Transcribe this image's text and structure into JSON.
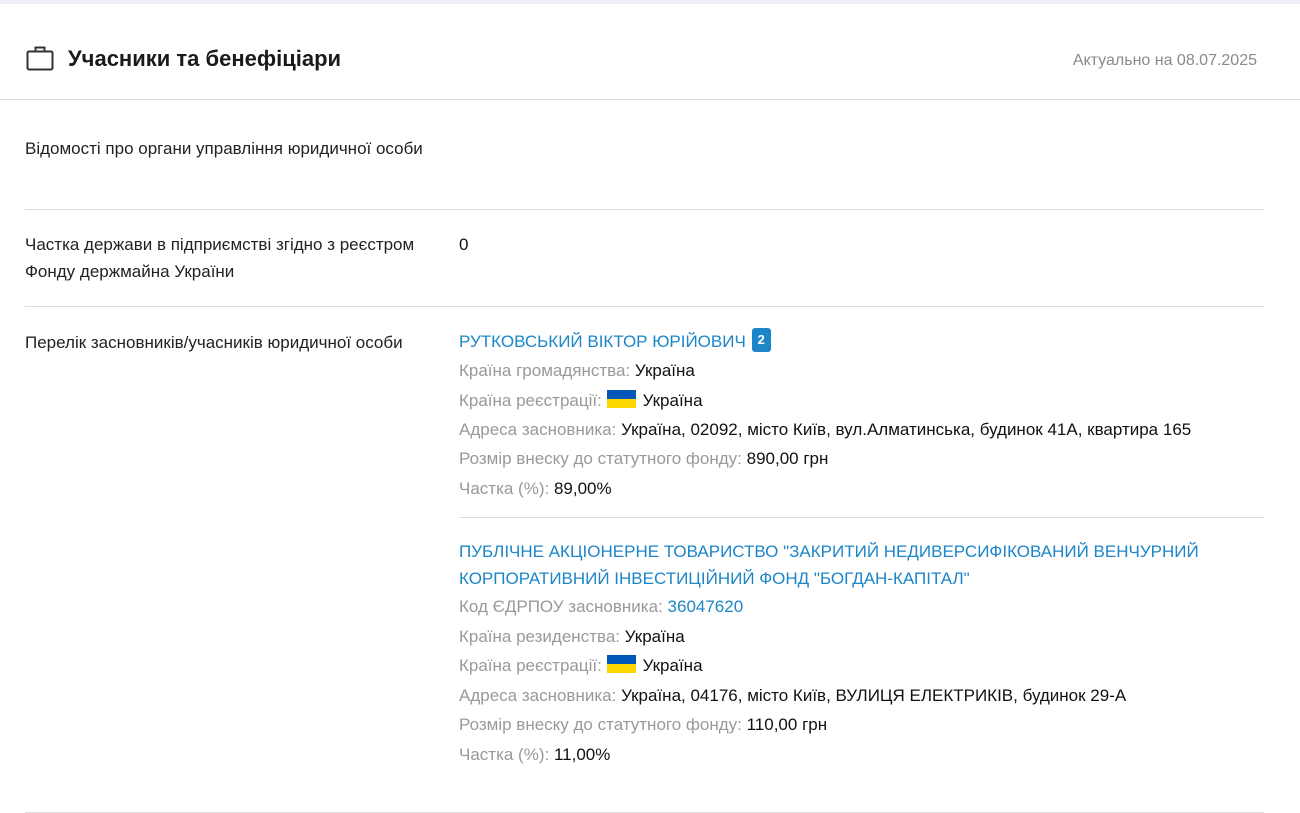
{
  "header": {
    "title": "Учасники та бенефіціари",
    "date": "Актуально на 08.07.2025"
  },
  "rows": {
    "governance": {
      "label": "Відомості про органи управління юридичної особи",
      "value": ""
    },
    "state_share": {
      "label": "Частка держави в підприємстві згідно з реєстром Фонду держмайна України",
      "value": "0"
    },
    "founders": {
      "label": "Перелік засновників/учасників юридичної особи",
      "items": [
        {
          "name": "РУТКОВСЬКИЙ ВІКТОР ЮРІЙОВИЧ",
          "badge": "2",
          "citizenship_key": "Країна громадянства:",
          "citizenship_val": "Україна",
          "reg_country_key": "Країна реєстрації:",
          "reg_country_val": "Україна",
          "address_key": "Адреса засновника:",
          "address_val": "Україна, 02092, місто Київ, вул.Алматинська, будинок 41А, квартира 165",
          "contribution_key": "Розмір внеску до статутного фонду:",
          "contribution_val": "890,00 грн",
          "share_key": "Частка (%):",
          "share_val": "89,00%"
        },
        {
          "name": "ПУБЛІЧНЕ АКЦІОНЕРНЕ ТОВАРИСТВО \"ЗАКРИТИЙ НЕДИВЕРСИФІКОВАНИЙ ВЕНЧУРНИЙ КОРПОРАТИВНИЙ ІНВЕСТИЦІЙНИЙ ФОНД \"БОГДАН-КАПІТАЛ\"",
          "edrpou_key": "Код ЄДРПОУ засновника:",
          "edrpou_val": "36047620",
          "residence_key": "Країна резиденства:",
          "residence_val": "Україна",
          "reg_country_key": "Країна реєстрації:",
          "reg_country_val": "Україна",
          "address_key": "Адреса засновника:",
          "address_val": "Україна, 04176, місто Київ, ВУЛИЦЯ ЕЛЕКТРИКІВ, будинок 29-А",
          "contribution_key": "Розмір внеску до статутного фонду:",
          "contribution_val": "110,00 грн",
          "share_key": "Частка (%):",
          "share_val": "11,00%"
        }
      ]
    }
  },
  "icons": {
    "header": "briefcase-icon",
    "flag": "ukraine-flag-icon"
  },
  "colors": {
    "link": "#1c86c8",
    "muted": "#999999",
    "flag_blue": "#0057b7",
    "flag_yellow": "#ffd700"
  }
}
